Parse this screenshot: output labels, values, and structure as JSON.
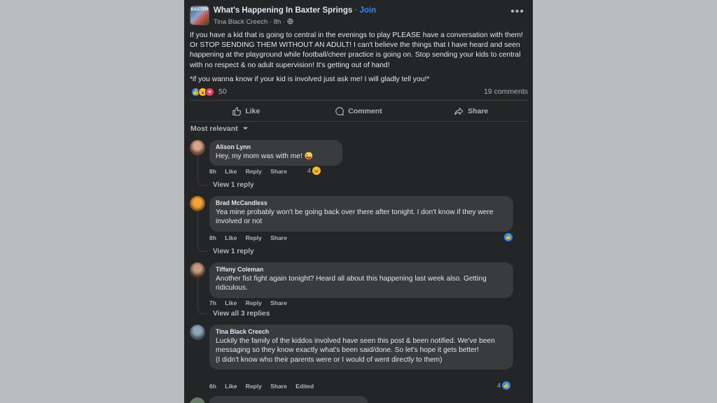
{
  "post": {
    "group_name": "What's Happening In Baxter Springs",
    "join_label": "· Join",
    "logo_text": "BAXTER",
    "author": "Tina Black Creech",
    "time": "· 8h ·",
    "globe_icon": "globe-icon",
    "more_icon": "ellipsis-icon",
    "paragraph_1": "If you have a kid that is going to central in the evenings to play PLEASE have a conversation with them! Or STOP SENDING THEM WITHOUT AN ADULT! I can't believe the things that I have heard and seen happening at the playground while football/cheer practice is going on. Stop sending your kids to central with no respect & no adult supervision! It's getting out of hand!",
    "paragraph_2": "*if you wanna know if your kid is involved just ask me! I will gladly tell you!*",
    "reaction_count": "50",
    "comment_count": "19 comments",
    "reaction_icons": [
      "like-icon",
      "wow-icon",
      "love-icon"
    ]
  },
  "actions": {
    "like": "Like",
    "comment": "Comment",
    "share": "Share"
  },
  "sort_label": "Most relevant",
  "comments": [
    {
      "name": "Alison Lynn",
      "text": "Hey, my mom was with me! 😜",
      "time": "8h",
      "like": "Like",
      "reply": "Reply",
      "share": "Share",
      "react_count": "4",
      "view_replies": "View 1 reply"
    },
    {
      "name": "Brad McCandless",
      "text": "Yea mine probably won't be going back over there after tonight. I don't know if they were involved or not",
      "time": "8h",
      "like": "Like",
      "reply": "Reply",
      "share": "Share",
      "react_count": "",
      "view_replies": "View 1 reply"
    },
    {
      "name": "Tiffany Coleman",
      "text": "Another fist fight again tonight? Heard all about this happening last week also. Getting ridiculous.",
      "time": "7h",
      "like": "Like",
      "reply": "Reply",
      "share": "Share",
      "react_count": "",
      "view_replies": "View all 3 replies"
    },
    {
      "name": "Tina Black Creech",
      "text": "Luckily the family of the kiddos involved have seen this post & been notified. We've been messaging so they know exactly what's been said/done. So let's hope it gets better!",
      "text_2": "(I didn't know who their parents were or I would of went directly to them)",
      "time": "6h",
      "like": "Like",
      "reply": "Reply",
      "share": "Share",
      "edited": "Edited",
      "react_count": "4"
    }
  ],
  "colors": {
    "background": "#242526",
    "bubble": "#3a3b3c",
    "text": "#e4e6eb",
    "muted": "#b0b3b8",
    "link": "#2d88ff"
  }
}
